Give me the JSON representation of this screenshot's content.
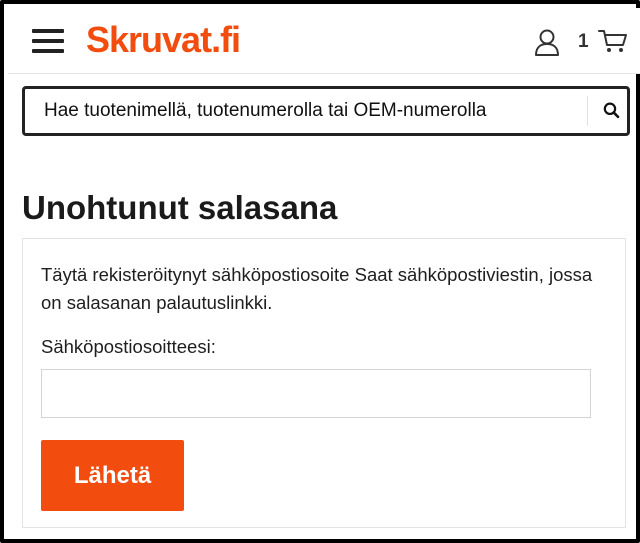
{
  "header": {
    "logo_text": "Skruvat.fi",
    "cart_count": "1",
    "icons": [
      "menu-icon",
      "user-icon",
      "cart-icon"
    ]
  },
  "search": {
    "placeholder": "Hae tuotenimellä, tuotenumerolla tai OEM-numerolla",
    "icon": "search-icon"
  },
  "page": {
    "title": "Unohtunut salasana",
    "description": "Täytä rekisteröitynyt sähköpostiosoite Saat sähköpostiviestin, jossa on salasanan palautuslinkki.",
    "email_label": "Sähköpostiosoitteesi:",
    "email_value": "",
    "submit_label": "Lähetä"
  },
  "colors": {
    "brand": "#f24c0e",
    "text": "#1e1e1e",
    "border": "#222222"
  }
}
